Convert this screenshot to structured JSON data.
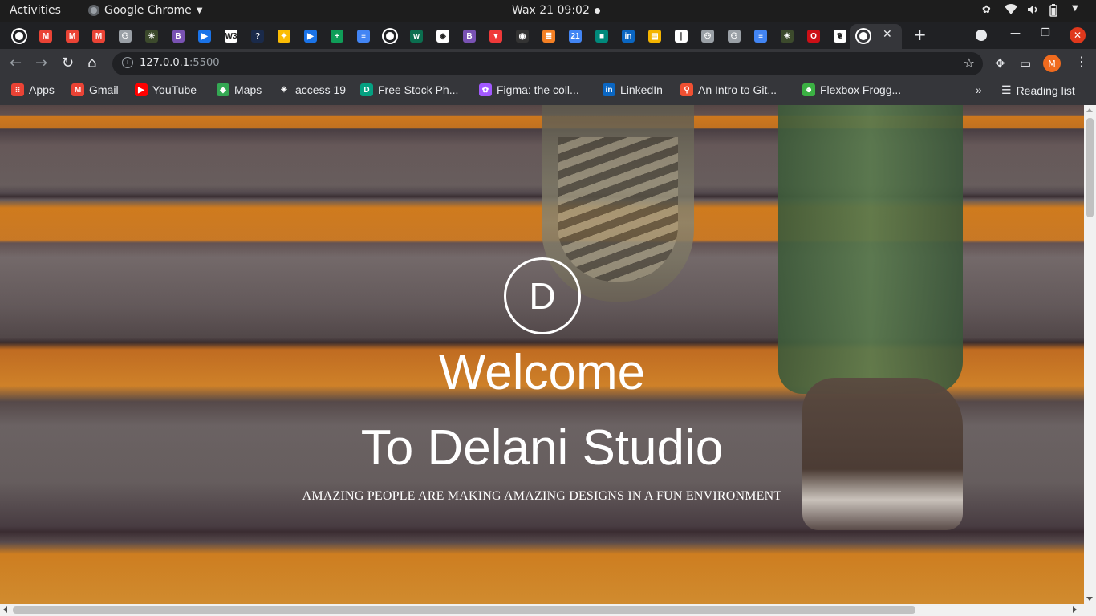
{
  "system_bar": {
    "activities": "Activities",
    "app_name": "Google Chrome",
    "clock": "Wax 21  09:02"
  },
  "tabs": [
    {
      "icon": "globe-icon",
      "color": "#ffffff",
      "glyph": ""
    },
    {
      "icon": "gmail-icon",
      "color": "#ea4335",
      "glyph": "M"
    },
    {
      "icon": "gmail-icon",
      "color": "#ea4335",
      "glyph": "M"
    },
    {
      "icon": "gmail-icon",
      "color": "#ea4335",
      "glyph": "M"
    },
    {
      "icon": "incognito-icon",
      "color": "#9aa0a6",
      "glyph": "⚇"
    },
    {
      "icon": "palm-icon",
      "color": "#3c4a2c",
      "glyph": "✳"
    },
    {
      "icon": "bootstrap-icon",
      "color": "#7952b3",
      "glyph": "B"
    },
    {
      "icon": "video-icon",
      "color": "#1a73e8",
      "glyph": "▶"
    },
    {
      "icon": "w3schools-icon",
      "color": "#ffffff",
      "glyph": "W3"
    },
    {
      "icon": "help-icon",
      "color": "#1a2a4a",
      "glyph": "?"
    },
    {
      "icon": "sites-icon",
      "color": "#fbbc04",
      "glyph": "✦"
    },
    {
      "icon": "video-icon",
      "color": "#1a73e8",
      "glyph": "▶"
    },
    {
      "icon": "sheets-plus-icon",
      "color": "#0f9d58",
      "glyph": "+"
    },
    {
      "icon": "docs-icon",
      "color": "#4285f4",
      "glyph": "≡"
    },
    {
      "icon": "globe-icon",
      "color": "#ffffff",
      "glyph": ""
    },
    {
      "icon": "w-icon",
      "color": "#0b6e4f",
      "glyph": "w"
    },
    {
      "icon": "codepen-icon",
      "color": "#ffffff",
      "glyph": "◈"
    },
    {
      "icon": "bootstrap-icon",
      "color": "#7952b3",
      "glyph": "B"
    },
    {
      "icon": "vivaldi-icon",
      "color": "#ef3939",
      "glyph": "▼"
    },
    {
      "icon": "github-icon",
      "color": "#333333",
      "glyph": "◉"
    },
    {
      "icon": "stackoverflow-icon",
      "color": "#f48024",
      "glyph": "≣"
    },
    {
      "icon": "calendar-icon",
      "color": "#4285f4",
      "glyph": "21"
    },
    {
      "icon": "meet-icon",
      "color": "#00897b",
      "glyph": "■"
    },
    {
      "icon": "linkedin-icon",
      "color": "#0a66c2",
      "glyph": "in"
    },
    {
      "icon": "slides-icon",
      "color": "#f4b400",
      "glyph": "▤"
    },
    {
      "icon": "document-icon",
      "color": "#ffffff",
      "glyph": "❘"
    },
    {
      "icon": "incognito-icon",
      "color": "#9aa0a6",
      "glyph": "⚇"
    },
    {
      "icon": "incognito-icon",
      "color": "#9aa0a6",
      "glyph": "⚇"
    },
    {
      "icon": "docs-icon",
      "color": "#4285f4",
      "glyph": "≡"
    },
    {
      "icon": "palm-icon",
      "color": "#3c4a2c",
      "glyph": "✳"
    },
    {
      "icon": "opera-icon",
      "color": "#cc0f16",
      "glyph": "O"
    },
    {
      "icon": "gnu-icon",
      "color": "#ffffff",
      "glyph": "❦"
    }
  ],
  "address_bar": {
    "host": "127.0.0.1",
    "port": ":5500"
  },
  "profile_initial": "M",
  "bookmarks": [
    {
      "icon": "apps-grid-icon",
      "label": "Apps",
      "color": "#ea4335",
      "glyph": "⁝⁝"
    },
    {
      "icon": "gmail-icon",
      "label": "Gmail",
      "color": "#ea4335",
      "glyph": "M"
    },
    {
      "icon": "youtube-icon",
      "label": "YouTube",
      "color": "#ff0000",
      "glyph": "▶"
    },
    {
      "icon": "maps-icon",
      "label": "Maps",
      "color": "#34a853",
      "glyph": "◆"
    },
    {
      "icon": "palm-icon",
      "label": "access 19",
      "color": "#35363a",
      "glyph": "✳"
    },
    {
      "icon": "stock-photos-icon",
      "label": "Free Stock Ph...",
      "color": "#05a081",
      "glyph": "D"
    },
    {
      "icon": "figma-icon",
      "label": "Figma: the coll...",
      "color": "#a259ff",
      "glyph": "✿"
    },
    {
      "icon": "linkedin-icon",
      "label": "LinkedIn",
      "color": "#0a66c2",
      "glyph": "in"
    },
    {
      "icon": "git-icon",
      "label": "An Intro to Git...",
      "color": "#f05032",
      "glyph": "⚲"
    },
    {
      "icon": "frog-icon",
      "label": "Flexbox Frogg...",
      "color": "#3bb143",
      "glyph": "☻"
    }
  ],
  "reading_list": "Reading list",
  "bookmarks_more": "»",
  "hero": {
    "logo_letter": "D",
    "welcome": "Welcome",
    "studio": "To Delani Studio",
    "tagline": "AMAZING PEOPLE ARE MAKING AMAZING DESIGNS IN A FUN ENVIRONMENT"
  }
}
